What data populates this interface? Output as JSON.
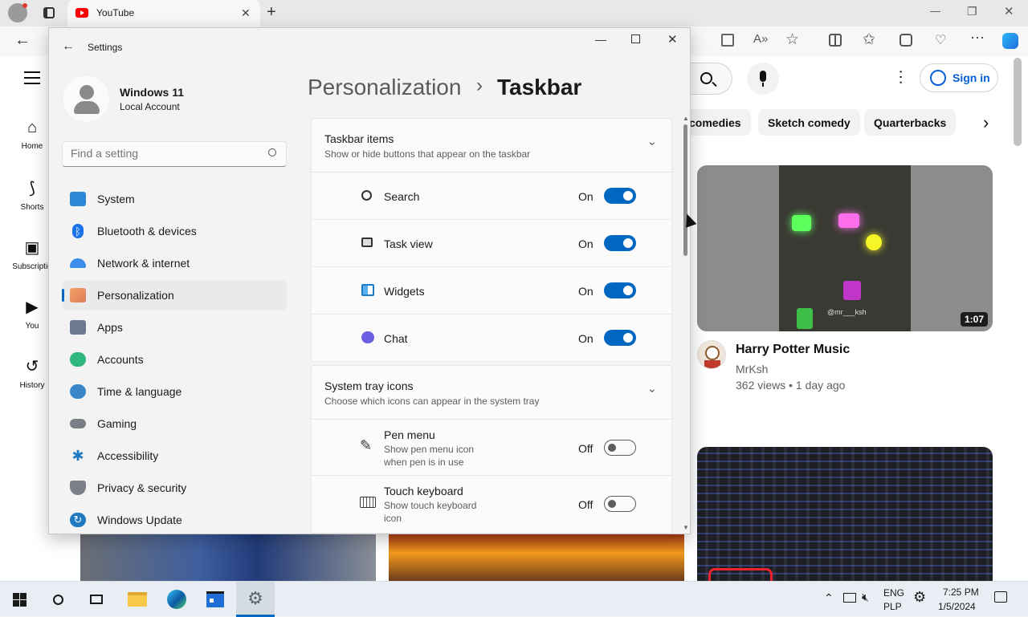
{
  "browser": {
    "tab_title": "YouTube",
    "new_tab": "+",
    "window_controls": {
      "minimize": "—",
      "restore": "❐",
      "close": "✕"
    }
  },
  "youtube": {
    "signin": "Sign in",
    "sidebar": [
      {
        "label": "Home",
        "icon": "home-icon"
      },
      {
        "label": "Shorts",
        "icon": "shorts-icon"
      },
      {
        "label": "Subscriptio",
        "icon": "subscriptions-icon"
      },
      {
        "label": "You",
        "icon": "you-icon"
      },
      {
        "label": "History",
        "icon": "history-icon"
      }
    ],
    "chips": [
      "comedies",
      "Sketch comedy",
      "Quarterbacks"
    ],
    "video": {
      "title": "Harry Potter Music",
      "channel": "MrKsh",
      "meta": "362 views • 1 day ago",
      "duration": "1:07",
      "watermark": "@mr___ksh"
    }
  },
  "settings": {
    "app_title": "Settings",
    "account_name": "Windows 11",
    "account_type": "Local Account",
    "search_placeholder": "Find a setting",
    "nav": [
      {
        "label": "System",
        "icon": "system-icon",
        "color": "#2b88d8"
      },
      {
        "label": "Bluetooth & devices",
        "icon": "bluetooth-icon",
        "color": "#1a73e8"
      },
      {
        "label": "Network & internet",
        "icon": "network-icon",
        "color": "#3b8eea"
      },
      {
        "label": "Personalization",
        "icon": "personalization-icon",
        "color": "#e07a5f"
      },
      {
        "label": "Apps",
        "icon": "apps-icon",
        "color": "#6b7a8f"
      },
      {
        "label": "Accounts",
        "icon": "accounts-icon",
        "color": "#2eb67d"
      },
      {
        "label": "Time & language",
        "icon": "time-language-icon",
        "color": "#3a86c8"
      },
      {
        "label": "Gaming",
        "icon": "gaming-icon",
        "color": "#7a7f87"
      },
      {
        "label": "Accessibility",
        "icon": "accessibility-icon",
        "color": "#1f7ac2"
      },
      {
        "label": "Privacy & security",
        "icon": "shield-icon",
        "color": "#7b8089"
      },
      {
        "label": "Windows Update",
        "icon": "windows-update-icon",
        "color": "#1f7ac2"
      }
    ],
    "breadcrumb_parent": "Personalization",
    "breadcrumb_sep": "›",
    "page_title": "Taskbar",
    "taskbar_items": {
      "title": "Taskbar items",
      "subtitle": "Show or hide buttons that appear on the taskbar",
      "rows": [
        {
          "label": "Search",
          "state": "On",
          "on": true,
          "icon": "search-icon"
        },
        {
          "label": "Task view",
          "state": "On",
          "on": true,
          "icon": "task-view-icon"
        },
        {
          "label": "Widgets",
          "state": "On",
          "on": true,
          "icon": "widgets-icon"
        },
        {
          "label": "Chat",
          "state": "On",
          "on": true,
          "icon": "chat-icon"
        }
      ]
    },
    "system_tray": {
      "title": "System tray icons",
      "subtitle": "Choose which icons can appear in the system tray",
      "rows": [
        {
          "label": "Pen menu",
          "desc1": "Show pen menu icon",
          "desc2": "when pen is in use",
          "state": "Off",
          "on": false,
          "icon": "pen-icon"
        },
        {
          "label": "Touch keyboard",
          "desc1": "Show touch keyboard",
          "desc2": "icon",
          "state": "Off",
          "on": false,
          "icon": "keyboard-icon"
        }
      ]
    }
  },
  "taskbar": {
    "lang1": "ENG",
    "lang2": "PLP",
    "time": "7:25 PM",
    "date": "1/5/2024"
  },
  "colors": {
    "accent": "#0067c0",
    "youtube_red": "#ff0000",
    "signin_blue": "#065fd4"
  }
}
